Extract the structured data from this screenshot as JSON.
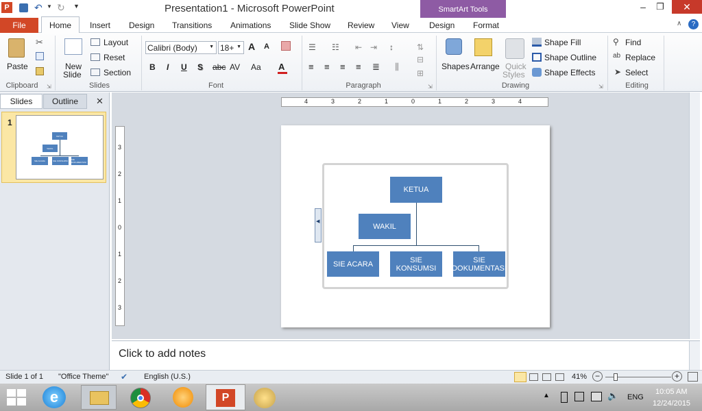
{
  "window": {
    "title": "Presentation1 - Microsoft PowerPoint",
    "contextual_tab_group": "SmartArt Tools"
  },
  "tabs": [
    "File",
    "Home",
    "Insert",
    "Design",
    "Transitions",
    "Animations",
    "Slide Show",
    "Review",
    "View",
    "Design",
    "Format"
  ],
  "ribbon": {
    "clipboard": {
      "paste": "Paste",
      "label": "Clipboard"
    },
    "slides": {
      "new_slide": "New",
      "new_slide2": "Slide",
      "layout": "Layout",
      "reset": "Reset",
      "section": "Section",
      "label": "Slides"
    },
    "font": {
      "name": "Calibri (Body)",
      "size": "18+",
      "label": "Font",
      "bold": "B",
      "italic": "I",
      "underline": "U",
      "shadow": "S",
      "strike": "abc",
      "spacing": "AV",
      "case": "Aa",
      "color": "A"
    },
    "paragraph": {
      "label": "Paragraph"
    },
    "drawing": {
      "shapes": "Shapes",
      "arrange": "Arrange",
      "quick_styles": "Quick",
      "quick_styles2": "Styles",
      "shape_fill": "Shape Fill",
      "shape_outline": "Shape Outline",
      "shape_effects": "Shape Effects",
      "label": "Drawing"
    },
    "editing": {
      "find": "Find",
      "replace": "Replace",
      "select": "Select",
      "label": "Editing"
    }
  },
  "pane": {
    "slides_tab": "Slides",
    "outline_tab": "Outline",
    "slide_number": "1"
  },
  "thumbnail": {
    "ketua": "KETUA",
    "wakil": "WAKIL",
    "acara": "SIE ACARA",
    "konsumsi": "SIE KONSUMSI",
    "dok": "SIE DOKUMENTASI"
  },
  "smartart": {
    "ketua": "KETUA",
    "wakil": "WAKIL",
    "acara": "SIE ACARA",
    "konsumsi": "SIE KONSUMSI",
    "dokumentasi_1": "SIE",
    "dokumentasi_2": "DOKUMENTASI"
  },
  "ruler": {
    "h_ticks": [
      "4",
      "3",
      "2",
      "1",
      "0",
      "1",
      "2",
      "3",
      "4"
    ],
    "v_ticks": [
      "3",
      "2",
      "1",
      "0",
      "1",
      "2",
      "3"
    ]
  },
  "notes": {
    "placeholder": "Click to add notes"
  },
  "status": {
    "slide": "Slide 1 of 1",
    "theme": "\"Office Theme\"",
    "language": "English (U.S.)",
    "zoom": "41%"
  },
  "taskbar": {
    "lang": "ENG",
    "time": "10:05 AM",
    "date": "12/24/2015"
  },
  "colors": {
    "file_tab": "#d24726",
    "smartart_accent": "#8e5ba4",
    "box": "#4f81bd"
  }
}
